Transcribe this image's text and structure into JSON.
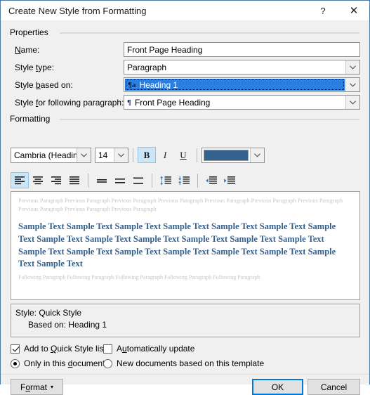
{
  "window": {
    "title": "Create New Style from Formatting",
    "help_button": "?",
    "close_button": "✕",
    "help_icon": "help-icon",
    "close_icon": "close-icon"
  },
  "properties": {
    "group_label": "Properties",
    "name_label": "Name:",
    "name_value": "Front Page Heading",
    "name_placeholder": "",
    "style_type_label": "Style type:",
    "style_type_value": "Paragraph",
    "style_based_on_label": "Style based on:",
    "style_based_on_value": "Heading 1",
    "style_based_on_icon": "¶a",
    "style_based_on_selected": true,
    "style_following_label": "Style for following paragraph:",
    "style_following_value": "Front Page Heading",
    "style_following_icon": "¶"
  },
  "formatting": {
    "group_label": "Formatting",
    "font_family": "Cambria (Headings)",
    "font_size": "14",
    "bold_label": "B",
    "italic_label": "I",
    "underline_label": "U",
    "bold_active": true,
    "italic_active": false,
    "underline_active": false,
    "font_color": "#35618E",
    "align_left_active": true
  },
  "preview": {
    "previous_paragraph": "Previous Paragraph Previous Paragraph Previous Paragraph Previous Paragraph Previous Paragraph Previous Paragraph Previous Paragraph Previous Paragraph Previous Paragraph Previous Paragraph",
    "sample_text": "Sample Text Sample Text Sample Text Sample Text Sample Text Sample Text Sample Text Sample Text Sample Text Sample Text Sample Text Sample Text Sample Text Sample Text Sample Text Sample Text Sample Text Sample Text Sample Text Sample Text Sample Text",
    "following_paragraph": "Following Paragraph Following Paragraph Following Paragraph Following Paragraph Following Paragraph"
  },
  "description": {
    "line1": "Style: Quick Style",
    "line2": "Based on: Heading 1"
  },
  "options": {
    "add_to_quick_style_label": "Add to Quick Style list",
    "add_to_quick_style_checked": true,
    "automatically_update_label": "Automatically update",
    "automatically_update_checked": false,
    "only_this_document_label": "Only in this document",
    "only_this_document_selected": true,
    "new_documents_label": "New documents based on this template",
    "new_documents_selected": false
  },
  "footer": {
    "format_label": "Format",
    "format_caret": "▾",
    "ok_label": "OK",
    "cancel_label": "Cancel"
  }
}
